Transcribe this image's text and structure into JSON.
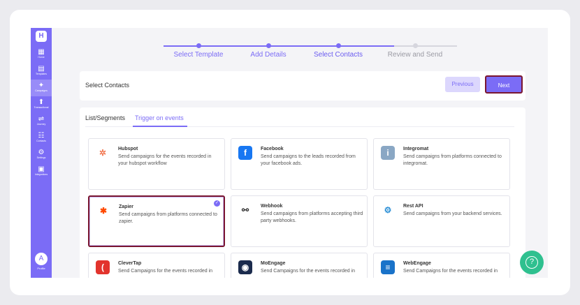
{
  "sidebar": {
    "logo": "H",
    "items": [
      {
        "label": "Home",
        "icon": "grid-icon",
        "glyph": "▦",
        "active": false
      },
      {
        "label": "Templates",
        "icon": "document-icon",
        "glyph": "▤",
        "active": false
      },
      {
        "label": "Campaigns",
        "icon": "megaphone-icon",
        "glyph": "✦",
        "active": true
      },
      {
        "label": "Transactional",
        "icon": "upload-icon",
        "glyph": "⬆",
        "active": false
      },
      {
        "label": "Journey",
        "icon": "journey-icon",
        "glyph": "⇌",
        "active": false
      },
      {
        "label": "Contacts",
        "icon": "contacts-icon",
        "glyph": "☷",
        "active": false
      },
      {
        "label": "Settings",
        "icon": "gear-icon",
        "glyph": "⚙",
        "active": false
      },
      {
        "label": "Integrations",
        "icon": "integrations-icon",
        "glyph": "▣",
        "active": false
      }
    ],
    "avatar": "A",
    "profile_label": "Profile"
  },
  "stepper": {
    "steps": [
      {
        "label": "Select Template",
        "state": "done"
      },
      {
        "label": "Add Details",
        "state": "done"
      },
      {
        "label": "Select Contacts",
        "state": "active"
      },
      {
        "label": "Review and Send",
        "state": "pending"
      }
    ]
  },
  "header": {
    "title": "Select Contacts",
    "prev_label": "Previous",
    "next_label": "Next"
  },
  "tabs": [
    {
      "label": "List/Segments",
      "active": false
    },
    {
      "label": "Trigger on events",
      "active": true
    }
  ],
  "integrations": [
    {
      "name": "Hubspot",
      "desc": "Send campaigns for the events recorded in your hubspot workflow",
      "icon": "hubspot-icon",
      "glyph": "✲",
      "color": "#f27a54",
      "bg": "#ffffff",
      "selected": false
    },
    {
      "name": "Facebook",
      "desc": "Send campaigns to the leads recorded from your facebook ads.",
      "icon": "facebook-icon",
      "glyph": "f",
      "color": "#ffffff",
      "bg": "#1877f2",
      "selected": false
    },
    {
      "name": "Integromat",
      "desc": "Send campaigns from platforms connected to integromat.",
      "icon": "integromat-icon",
      "glyph": "i",
      "color": "#ffffff",
      "bg": "#8aa7c4",
      "selected": false
    },
    {
      "name": "Zapier",
      "desc": "Send campaigns from platforms connected to zapier.",
      "icon": "zapier-icon",
      "glyph": "✱",
      "color": "#ff4a00",
      "bg": "#ffffff",
      "selected": true
    },
    {
      "name": "Webhook",
      "desc": "Send campaigns from platforms accepting third party webhooks.",
      "icon": "webhook-icon",
      "glyph": "⚯",
      "color": "#333333",
      "bg": "#ffffff",
      "selected": false
    },
    {
      "name": "Rest API",
      "desc": "Send campaigns from your backend services.",
      "icon": "api-icon",
      "glyph": "⚙",
      "color": "#2b8fd6",
      "bg": "#ffffff",
      "selected": false
    },
    {
      "name": "CleverTap",
      "desc": "Send Campaigns for the events recorded in",
      "icon": "clevertap-icon",
      "glyph": "(",
      "color": "#ffffff",
      "bg": "#e2342d",
      "selected": false
    },
    {
      "name": "MoEngage",
      "desc": "Send Campaigns for the events recorded in",
      "icon": "moengage-icon",
      "glyph": "◉",
      "color": "#ffffff",
      "bg": "#1b2b4d",
      "selected": false
    },
    {
      "name": "WebEngage",
      "desc": "Send Campaigns for the events recorded in",
      "icon": "webengage-icon",
      "glyph": "≡",
      "color": "#ffffff",
      "bg": "#1a73c9",
      "selected": false
    }
  ],
  "help_glyph": "?"
}
